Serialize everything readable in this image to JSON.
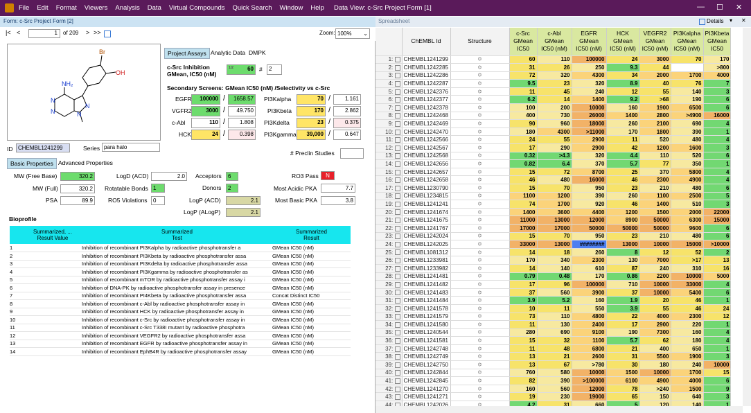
{
  "app": {
    "menu": [
      "File",
      "Edit",
      "Format",
      "Viewers",
      "Analysis",
      "Data",
      "Virtual Compounds",
      "Quick Search",
      "Window",
      "Help"
    ],
    "window_title": "Data View: c-Src Project Form [1]",
    "min": "—",
    "max": "☐",
    "close": "✕"
  },
  "form": {
    "title": "Form: c-Src Project Form [2]",
    "record": "1",
    "of": "of 209",
    "zoom_label": "Zoom:",
    "zoom": "100%",
    "id_label": "ID",
    "id": "CHEMBL1241299",
    "series_label": "Series",
    "series": "para halo",
    "tabs": [
      "Project Assays",
      "Analytic Data",
      "DMPK"
    ],
    "csrc": {
      "title": "c-Src Inhibition",
      "subtitle": "GMean, IC50 (nM)",
      "value": "60",
      "count": "1/2",
      "hash": "#",
      "n": "2"
    },
    "secondary_title": "Secondary Screens: GMean IC50 (nM) /Selectivity vs c-Src",
    "left_assays": [
      {
        "name": "EGFR",
        "value": "100000",
        "sel": "1658.57",
        "cls": "green",
        "scls": "green"
      },
      {
        "name": "VGFR2",
        "value": "3000",
        "sel": "49.750",
        "cls": "green",
        "scls": "white"
      },
      {
        "name": "c-Abl",
        "value": "110",
        "sel": "1.808",
        "cls": "white",
        "scls": "white"
      },
      {
        "name": "HCK",
        "value": "24",
        "sel": "0.398",
        "cls": "yellow",
        "scls": "pink"
      }
    ],
    "right_assays": [
      {
        "name": "PI3Kalpha",
        "value": "70",
        "sel": "1.161",
        "cls": "yellow",
        "scls": "white"
      },
      {
        "name": "PI3Kbeta",
        "value": "170",
        "sel": "2.862",
        "cls": "yellow",
        "scls": "white"
      },
      {
        "name": "PI3Kdelta",
        "value": "23",
        "sel": "0.375",
        "cls": "yellow",
        "scls": "pink"
      },
      {
        "name": "PI3Kgamma",
        "value": "39,000",
        "sel": "0.647",
        "cls": "yellow",
        "scls": "white"
      }
    ],
    "preclin_label": "# Preclin Studies",
    "prop_tabs": [
      "Basic Properties",
      "Advanced Properties"
    ],
    "props": {
      "mw_free_label": "MW (Free Base)",
      "mw_free": "320.2",
      "mw_full_label": "MW (Full)",
      "mw_full": "320.2",
      "psa_label": "PSA",
      "psa": "89.9",
      "logd_label": "LogD (ACD)",
      "logd": "2.0",
      "rotb_label": "Rotatable Bonds",
      "rotb": "1",
      "ro5_label": "RO5 Violations",
      "ro5": "0",
      "acc_label": "Acceptors",
      "acc": "6",
      "don_label": "Donors",
      "don": "2",
      "logp_acd_label": "LogP (ACD)",
      "logp_acd": "2.1",
      "logp_alogp_label": "LogP (ALogP)",
      "logp_alogp": "2.1",
      "ro3_label": "RO3 Pass",
      "ro3": "N",
      "pka_acid_label": "Most Acidic PKA",
      "pka_acid": "7.7",
      "pka_base_label": "Most Basic PKA",
      "pka_base": "3.8"
    },
    "bioprofile": {
      "title": "Bioprofile",
      "headers": [
        "Summarized, ...\nResult Value",
        "Summarized\nTest",
        "Summarized\nResult"
      ],
      "rows": [
        [
          "1",
          "Inhibition of recombinant PI3Kalpha by radioactive phosphotransfer a",
          "GMean IC50 (nM)"
        ],
        [
          "2",
          "Inhibition of recombinant PI3Kbeta by radioactive phosphotransfer assa",
          "GMean IC50 (nM)"
        ],
        [
          "3",
          "Inhibition of recombinant PI3Kdelta by radioactive phosphotransfer assa",
          "GMean IC50 (nM)"
        ],
        [
          "4",
          "Inhibition of recombinant PI3Kgamma by radioactive phosphotransfer as",
          "GMean IC50 (nM)"
        ],
        [
          "5",
          "Inhibition of recombinant mTOR by radioactive phosphotransfer assay i",
          "GMean IC50 (nM)"
        ],
        [
          "6",
          "Inhibition of DNA-PK by radioactive phosphotransfer assay in presence",
          "GMean IC50 (nM)"
        ],
        [
          "7",
          "Inhibition of recombinant PI4Kbeta by radioactive phosphotransfer assa",
          "Concat Distinct IC50"
        ],
        [
          "8",
          "Inhibition of recombinant c-Abl by radioactive phosphotransfer assay in",
          "GMean IC50 (nM)"
        ],
        [
          "9",
          "Inhibition of recombinant HCK by radioactive phosphotransfer assay in",
          "GMean IC50 (nM)"
        ],
        [
          "10",
          "Inhibition of recombinant c-Src by radioactive phosphotransfer assay in",
          "GMean IC50 (nM)"
        ],
        [
          "11",
          "Inhibition of recombinant c-Src T338I mutant by radioactive phosphotra",
          "GMean IC50 (nM)"
        ],
        [
          "12",
          "Inhibition of recombinant VEGFR2 by radioactive phosphotransfer assa",
          "GMean IC50 (nM)"
        ],
        [
          "13",
          "Inhibition of recombinant EGFR by radioactive phosphotransfer assay in",
          "GMean IC50 (nM)"
        ],
        [
          "14",
          "Inhibition of recombinant EphB4R by radioactive phosphotransfer assay",
          "GMean IC50 (nM)"
        ]
      ]
    }
  },
  "sheet": {
    "title": "Spreadsheet",
    "details": "Details",
    "headers": [
      "",
      "ChEMBL Id",
      "Structure",
      "c-Src GMean IC50",
      "c-Abl GMean IC50 (nM)",
      "EGFR GMean IC50 (nM)",
      "HCK GMean IC50 (nM)",
      "VEGFR2 GMean IC50 (nM)",
      "PI3Kalpha GMean IC50 (nM)",
      "PI3Kbeta GMean IC50"
    ],
    "rows": [
      [
        "1:",
        "CHEMBL1241299",
        "60",
        "110",
        "100000",
        "24",
        "3000",
        "70",
        "170"
      ],
      [
        "2:",
        "CHEMBL1242285",
        "31",
        "26",
        "250",
        "9.3",
        "44",
        "",
        ">800"
      ],
      [
        "3:",
        "CHEMBL1242286",
        "72",
        "320",
        "4300",
        "34",
        "2000",
        "1700",
        "4000"
      ],
      [
        "4:",
        "CHEMBL1242287",
        "9.5",
        "23",
        "320",
        "8.9",
        "40",
        "76",
        "7"
      ],
      [
        "5:",
        "CHEMBL1242376",
        "11",
        "45",
        "240",
        "12",
        "55",
        "140",
        "3"
      ],
      [
        "6:",
        "CHEMBL1242377",
        "6.2",
        "14",
        "1400",
        "9.2",
        ">68",
        "190",
        "6"
      ],
      [
        "7:",
        "CHEMBL1242378",
        "100",
        "200",
        "10000",
        "160",
        "1900",
        "6500",
        "6"
      ],
      [
        "8:",
        "CHEMBL1242468",
        "400",
        "730",
        "26000",
        "1400",
        "2800",
        ">4900",
        "16000"
      ],
      [
        "9:",
        "CHEMBL1242469",
        "90",
        "960",
        "18000",
        "260",
        "2100",
        "690",
        "4"
      ],
      [
        "10:",
        "CHEMBL1242470",
        "180",
        "4300",
        ">11000",
        "170",
        "1800",
        "390",
        "1"
      ],
      [
        "11:",
        "CHEMBL1242566",
        "24",
        "55",
        "2900",
        "11",
        "520",
        "480",
        "4"
      ],
      [
        "12:",
        "CHEMBL1242567",
        "17",
        "290",
        "2900",
        "42",
        "1200",
        "1600",
        "3"
      ],
      [
        "13:",
        "CHEMBL1242568",
        "0.32",
        ">4.3",
        "320",
        "4.4",
        "110",
        "520",
        "6"
      ],
      [
        "14:",
        "CHEMBL1242656",
        "0.82",
        "6.4",
        "370",
        "5.7",
        "77",
        "350",
        "1"
      ],
      [
        "15:",
        "CHEMBL1242657",
        "15",
        "72",
        "8700",
        "25",
        "370",
        "5800",
        "4"
      ],
      [
        "16:",
        "CHEMBL1242658",
        "46",
        "480",
        "16000",
        "46",
        "2300",
        "4900",
        "4"
      ],
      [
        "17:",
        "CHEMBL1230790",
        "15",
        "70",
        "950",
        "23",
        "210",
        "480",
        "6"
      ],
      [
        "18:",
        "CHEMBL1234815",
        "1100",
        "1200",
        "390",
        "260",
        "1100",
        "2500",
        "5"
      ],
      [
        "19:",
        "CHEMBL1241241",
        "74",
        "1700",
        "920",
        "46",
        "1400",
        "510",
        "3"
      ],
      [
        "20:",
        "CHEMBL1241674",
        "1400",
        "3600",
        "4400",
        "1200",
        "1500",
        "2000",
        "22000"
      ],
      [
        "21:",
        "CHEMBL1241675",
        "11000",
        "13000",
        "12000",
        "8900",
        "50000",
        "6300",
        "15000"
      ],
      [
        "22:",
        "CHEMBL1241767",
        "17000",
        "17000",
        "50000",
        "50000",
        "50000",
        "9600",
        "6"
      ],
      [
        "23:",
        "CHEMBL1242024",
        "15",
        "70",
        "950",
        "23",
        "210",
        "480",
        "6"
      ],
      [
        "24:",
        "CHEMBL1242025",
        "33000",
        "13000",
        "########",
        "13000",
        "10000",
        "15000",
        ">10000"
      ],
      [
        "25:",
        "CHEMBL1081312",
        "14",
        "18",
        "260",
        "8",
        "12",
        "52",
        "2"
      ],
      [
        "26:",
        "CHEMBL1233981",
        "170",
        "340",
        "2300",
        "130",
        "7000",
        ">17",
        "13"
      ],
      [
        "27:",
        "CHEMBL1233982",
        "14",
        "140",
        "610",
        "87",
        "240",
        "310",
        "16"
      ],
      [
        "28:",
        "CHEMBL1241481",
        "0.79",
        "0.48",
        "170",
        "0.86",
        "2200",
        "10000",
        "5000"
      ],
      [
        "29:",
        "CHEMBL1241482",
        "17",
        "96",
        "100000",
        "710",
        "10000",
        "33000",
        "4"
      ],
      [
        "30:",
        "CHEMBL1241483",
        "37",
        "560",
        "3900",
        "37",
        "10000",
        "5400",
        "6"
      ],
      [
        "31:",
        "CHEMBL1241484",
        "3.9",
        "5.2",
        "160",
        "1.9",
        "20",
        "46",
        "1"
      ],
      [
        "32:",
        "CHEMBL1241578",
        "10",
        "11",
        "550",
        "3.9",
        "55",
        "46",
        "24"
      ],
      [
        "33:",
        "CHEMBL1241579",
        "73",
        "110",
        "4800",
        "22",
        "4000",
        "2300",
        "12"
      ],
      [
        "34:",
        "CHEMBL1241580",
        "11",
        "130",
        "2400",
        "17",
        "2900",
        "220",
        "1"
      ],
      [
        "35:",
        "CHEMBL1240544",
        "280",
        "690",
        "9100",
        "190",
        "7300",
        "160",
        "4"
      ],
      [
        "36:",
        "CHEMBL1241581",
        "15",
        "32",
        "1100",
        "5.7",
        "62",
        "180",
        "4"
      ],
      [
        "37:",
        "CHEMBL1242748",
        "11",
        "48",
        "6800",
        "21",
        "400",
        "650",
        "1"
      ],
      [
        "38:",
        "CHEMBL1242749",
        "13",
        "21",
        "2600",
        "31",
        "5500",
        "1900",
        "3"
      ],
      [
        "39:",
        "CHEMBL1242750",
        "13",
        "67",
        ">780",
        "30",
        "180",
        "240",
        "10000"
      ],
      [
        "40:",
        "CHEMBL1242844",
        "760",
        "580",
        "10000",
        "1500",
        "10000",
        "1700",
        "15"
      ],
      [
        "41:",
        "CHEMBL1242845",
        "82",
        "390",
        ">100000",
        "6100",
        "4900",
        "4000",
        "6"
      ],
      [
        "42:",
        "CHEMBL1241270",
        "160",
        "560",
        "12000",
        "78",
        ">240",
        "1500",
        "9"
      ],
      [
        "43:",
        "CHEMBL1241271",
        "19",
        "230",
        "19000",
        "65",
        "150",
        "640",
        "3"
      ],
      [
        "44:",
        "CHEMBL1242026",
        "4.2",
        "31",
        "660",
        "5",
        "120",
        "140",
        "1"
      ]
    ]
  }
}
